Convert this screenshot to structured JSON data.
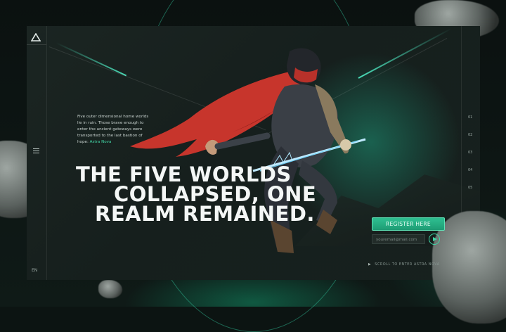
{
  "intro": {
    "text": "Five outer dimensional home worlds lie in ruin. Those brave enough to enter the ancient gateways were transported to the last bastion of hope:",
    "link": "Astra Nova"
  },
  "headline": {
    "line1": "THE FIVE WORLDS",
    "line2": "COLLAPSED, ONE",
    "line3": "REALM REMAINED."
  },
  "nav": {
    "indices": [
      "01",
      "02",
      "03",
      "04",
      "05"
    ],
    "language": "EN"
  },
  "signup": {
    "register_label": "REGISTER HERE",
    "email_placeholder": "youremail@mail.com"
  },
  "scroll": {
    "label": "SCROLL TO ENTER ASTRA NOVA"
  },
  "colors": {
    "accent": "#2fbf91",
    "background": "#0c1412",
    "panel": "#1b2522"
  },
  "icons": [
    "triangle-logo-icon",
    "menu-icon",
    "play-arrow-icon",
    "scroll-arrow-icon"
  ]
}
